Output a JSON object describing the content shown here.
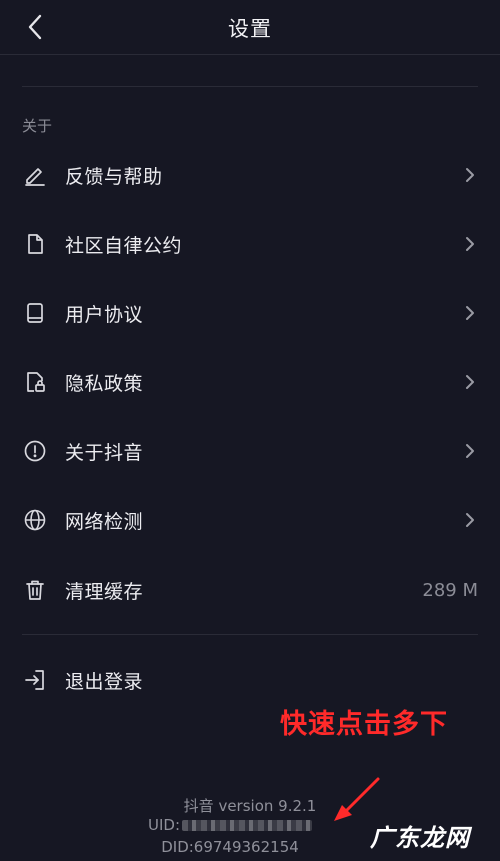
{
  "header": {
    "title": "设置"
  },
  "section": {
    "label": "关于"
  },
  "items": [
    {
      "label": "反馈与帮助",
      "icon": "edit-icon"
    },
    {
      "label": "社区自律公约",
      "icon": "document-icon"
    },
    {
      "label": "用户协议",
      "icon": "book-icon"
    },
    {
      "label": "隐私政策",
      "icon": "lock-document-icon"
    },
    {
      "label": "关于抖音",
      "icon": "info-icon"
    },
    {
      "label": "网络检测",
      "icon": "globe-icon"
    },
    {
      "label": "清理缓存",
      "icon": "trash-icon",
      "value": "289 M"
    }
  ],
  "logout": {
    "label": "退出登录",
    "icon": "logout-icon"
  },
  "annotation": {
    "text": "快速点击多下",
    "color": "#ff2a2a"
  },
  "footer": {
    "version": "抖音 version 9.2.1",
    "uid_label": "UID:",
    "did": "DID:69749362154"
  },
  "watermark": {
    "text": "广东龙网"
  },
  "colors": {
    "background": "#161723",
    "text": "#ececf0",
    "muted": "#8b8c96",
    "annotation": "#ff2a2a"
  }
}
